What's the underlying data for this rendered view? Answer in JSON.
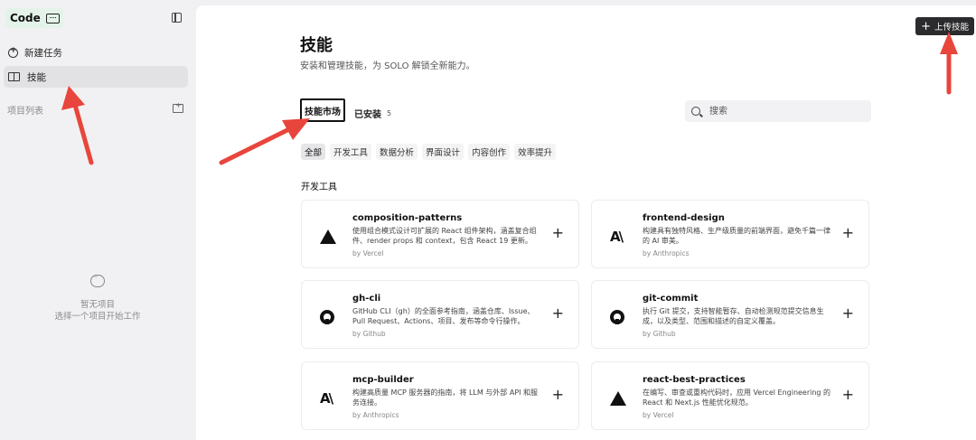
{
  "sidebar": {
    "brand": "Code",
    "nav": [
      {
        "label": "新建任务",
        "icon": "new-chat-icon"
      },
      {
        "label": "技能",
        "icon": "book-icon",
        "active": true
      }
    ],
    "section_label": "项目列表",
    "empty_title": "暂无项目",
    "empty_sub": "选择一个项目开始工作"
  },
  "main": {
    "upload_label": "上传技能",
    "title": "技能",
    "subtitle": "安装和管理技能，为 SOLO 解锁全新能力。",
    "tabs": [
      {
        "label": "技能市场",
        "active": true
      },
      {
        "label": "已安装",
        "count": "5"
      }
    ],
    "search": {
      "placeholder": "搜索",
      "value": ""
    },
    "filters": [
      "全部",
      "开发工具",
      "数据分析",
      "界面设计",
      "内容创作",
      "效率提升"
    ],
    "group_title": "开发工具",
    "cards": [
      {
        "name": "composition-patterns",
        "desc": "使用组合模式设计可扩展的 React 组件架构，涵盖复合组件、render props 和 context，包含 React 19 更新。",
        "by": "by Vercel",
        "logo": "vercel-icon"
      },
      {
        "name": "frontend-design",
        "desc": "构建具有独特风格、生产级质量的前端界面，避免千篇一律的 AI 审美。",
        "by": "by Anthropics",
        "logo": "anthropic-icon"
      },
      {
        "name": "gh-cli",
        "desc": "GitHub CLI（gh）的全面参考指南，涵盖仓库、Issue、Pull Request、Actions、项目、发布等命令行操作。",
        "by": "by Github",
        "logo": "github-icon"
      },
      {
        "name": "git-commit",
        "desc": "执行 Git 提交，支持智能暂存、自动检测规范提交信息生成，以及类型、范围和描述的自定义覆盖。",
        "by": "by Github",
        "logo": "github-icon"
      },
      {
        "name": "mcp-builder",
        "desc": "构建高质量 MCP 服务器的指南，将 LLM 与外部 API 和服务连接。",
        "by": "by Anthropics",
        "logo": "anthropic-icon"
      },
      {
        "name": "react-best-practices",
        "desc": "在编写、审查或重构代码时，应用 Vercel Engineering 的 React 和 Next.js 性能优化规范。",
        "by": "by Vercel",
        "logo": "vercel-icon"
      }
    ]
  },
  "colors": {
    "arrow": "#e8453c",
    "brand_bg": "#e4f3ea",
    "upload_bg": "#2b2b2d"
  }
}
